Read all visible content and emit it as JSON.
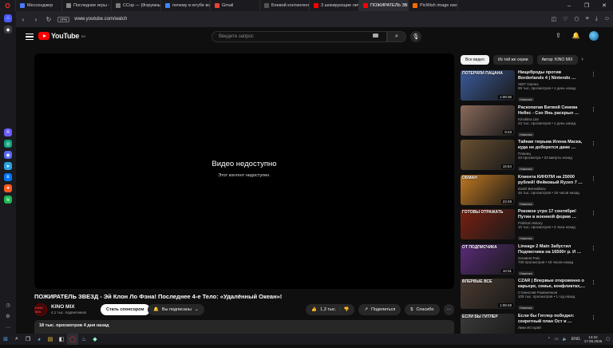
{
  "browser": {
    "tabs": [
      {
        "label": "Мессенджер",
        "color": "#4a7bff",
        "active": false
      },
      {
        "label": "Последние игры - Inv…",
        "color": "#888888",
        "active": false
      },
      {
        "label": "СCop — [Форумные игр…",
        "color": "#7a7a7a",
        "active": false
      },
      {
        "label": "почему в ютубе все вид…",
        "color": "#4285f4",
        "active": false
      },
      {
        "label": "Gmail",
        "color": "#ea4335",
        "active": false
      },
      {
        "label": "Боевой контингент 2i Нет…",
        "color": "#555555",
        "active": false
      },
      {
        "label": "3 шокирующие личност…",
        "color": "#ff0000",
        "active": false
      },
      {
        "label": "ПОЖИРАТЕЛЬ ЗВЕЗД - …",
        "color": "#ff0000",
        "active": true
      },
      {
        "label": "PicWish image изображ…",
        "color": "#ff6a00",
        "active": false
      }
    ],
    "vpn_label": "VPN",
    "url": "www.youtube.com/watch"
  },
  "youtube": {
    "logo_text": "YouTube",
    "region": "BY",
    "search_placeholder": "Введите запрос",
    "player": {
      "title": "Видео недоступно",
      "subtitle": "Этот контент недоступен."
    },
    "video_title": "ПОЖИРАТЕЛЬ ЗВЕЗД - Эй Клон Ло Фэна! Последнее 4-е Тело: «Удалённый Океан»!",
    "channel": {
      "avatar_text": "KINO MIX",
      "name": "KINO MIX",
      "subscribers": "4,1 тыс. подписчиков"
    },
    "sponsor_label": "Стать спонсором",
    "subscribed_label": "Вы подписаны",
    "likes": "1,3 тыс.",
    "share_label": "Поделиться",
    "thanks_label": "Спасибо",
    "description_stats": "18 тыс. просмотров  4 дня назад",
    "chips": [
      "Все видео",
      "Из той же серии",
      "Автор: KINO MIX"
    ],
    "recommendations": [
      {
        "thumb_text": "ПОТЕРЯЛИ ПАЦАНА",
        "thumb_bg": "#3a5a9a",
        "duration": "1:08:36",
        "title": "Нищеброды против Borderlands 4 | Nintendo …",
        "channel": "XBIT Games",
        "meta": "99 тыс. просмотров • 1 день назад",
        "badge": "Новинка"
      },
      {
        "thumb_text": "",
        "thumb_bg": "#8a6a5a",
        "duration": "9:23",
        "title": "Раскопатая Битвой Синева Небес - Сэо Янь раскрыл …",
        "channel": "Kinokitra Lite",
        "meta": "23 тыс. просмотров • 1 день назад",
        "badge": "Новинка"
      },
      {
        "thumb_text": "",
        "thumb_bg": "#6a5030",
        "duration": "16:54",
        "title": "Тайная тюрьма Илона Маска, куда не доберется даже …",
        "channel": "Планец",
        "meta": "33 просмотра • 23 минуты назад",
        "badge": "Новинка"
      },
      {
        "thumb_text": "ОБМАН",
        "thumb_bg": "#c07820",
        "duration": "23:48",
        "title": "Клиента КИНУЛИ на 25000 рублей! Фейковый Ryzen 7 …",
        "channel": "Daniil Benediktov",
        "meta": "46 тыс. просмотров • 19 часов назад",
        "badge": "Новинка"
      },
      {
        "thumb_text": "ГОТОВЫ ОТРАЖАТЬ",
        "thumb_bg": "#7a2010",
        "duration": "",
        "title": "Роковое утро 17 сентября! Путин в военной форме …",
        "channel": "Political History",
        "meta": "10 тыс. просмотров • 2 часа назад",
        "badge": "Новинка"
      },
      {
        "thumb_text": "ОТ ПОДПИСЧИКА",
        "thumb_bg": "#5a2a7a",
        "duration": "10:31",
        "title": "Lineage 2 Main Забустил Подписчика на 16500т р. И …",
        "channel": "Greatest Pain",
        "meta": "730 просмотров • 18 часов назад",
        "badge": "Новинка"
      },
      {
        "thumb_text": "ВПЕРВЫЕ ВСЕ",
        "thumb_bg": "#4a3a30",
        "duration": "1:08:48",
        "title": "CZAR | Впервые откровенно о карьере, семье, конфликтах,…",
        "channel": "Станислав Романенков",
        "meta": "105 тыс. просмотров • 1 год назад",
        "badge": "Новинка"
      },
      {
        "thumb_text": "ЕСЛИ БЫ ГИТЛЕР",
        "thumb_bg": "#3a3a3a",
        "duration": "",
        "title": "Если бы Гитлер победил: секретный план Ост и …",
        "channel": "Лики Историй",
        "meta": "",
        "badge": ""
      }
    ]
  },
  "taskbar": {
    "lang": "ENG",
    "time": "13:22",
    "date": "17.09.2025"
  }
}
